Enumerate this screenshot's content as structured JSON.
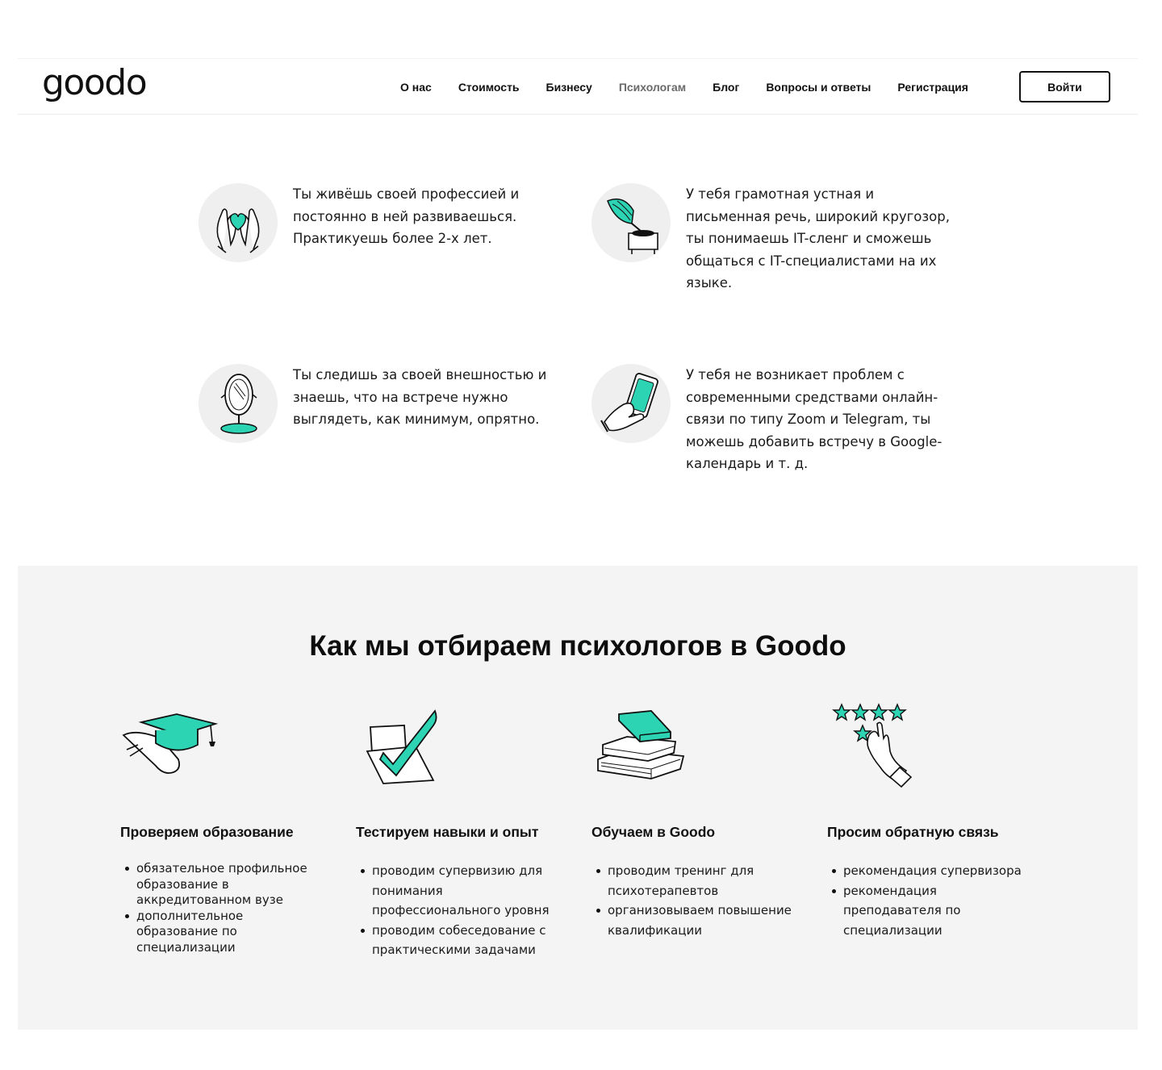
{
  "header": {
    "logo": "goodo",
    "nav": [
      {
        "label": "О нас",
        "active": false
      },
      {
        "label": "Стоимость",
        "active": false
      },
      {
        "label": "Бизнесу",
        "active": false
      },
      {
        "label": "Психологам",
        "active": true
      },
      {
        "label": "Блог",
        "active": false
      },
      {
        "label": "Вопросы и ответы",
        "active": false
      },
      {
        "label": "Регистрация",
        "active": false
      }
    ],
    "login_label": "Войти"
  },
  "requirements": [
    {
      "icon": "heart-hands-icon",
      "text": "Ты живёшь своей профессией и постоянно в ней развиваешься. Практикуешь более 2-х лет."
    },
    {
      "icon": "gramophone-icon",
      "text": "У тебя грамотная устная и письменная речь, широкий кругозор, ты понимаешь IT-сленг и сможешь общаться с IT-специалистами на их языке."
    },
    {
      "icon": "mirror-icon",
      "text": "Ты следишь за своей внешностью и знаешь, что на встрече нужно выглядеть, как минимум, опрятно."
    },
    {
      "icon": "phone-in-hand-icon",
      "text": "У тебя не возникает проблем с современными средствами онлайн-связи по типу Zoom и Telegram, ты можешь добавить встречу в Google-календарь и т. д."
    }
  ],
  "selection": {
    "title": "Как мы отбираем психологов в Goodo",
    "columns": [
      {
        "icon": "graduation-cap-icon",
        "heading": "Проверяем образование",
        "items": [
          "обязательное профильное образование в аккредитованном вузе",
          "дополнительное образование по специализации"
        ]
      },
      {
        "icon": "checkmark-icon",
        "heading": "Тестируем навыки и опыт",
        "items": [
          "проводим супервизию для понимания профессионального уровня",
          "проводим собеседование с практическими задачами"
        ]
      },
      {
        "icon": "books-icon",
        "heading": "Обучаем в Goodo",
        "items": [
          "проводим тренинг для психотерапевтов",
          "организовываем повышение квалификации"
        ]
      },
      {
        "icon": "rating-stars-icon",
        "heading": "Просим обратную связь",
        "items": [
          "рекомендация супервизора",
          "рекомендация преподавателя по специализации"
        ]
      }
    ]
  },
  "colors": {
    "accent": "#2dd4b4",
    "text": "#111111",
    "section_bg": "#f4f4f4",
    "icon_bg": "#efefef"
  }
}
